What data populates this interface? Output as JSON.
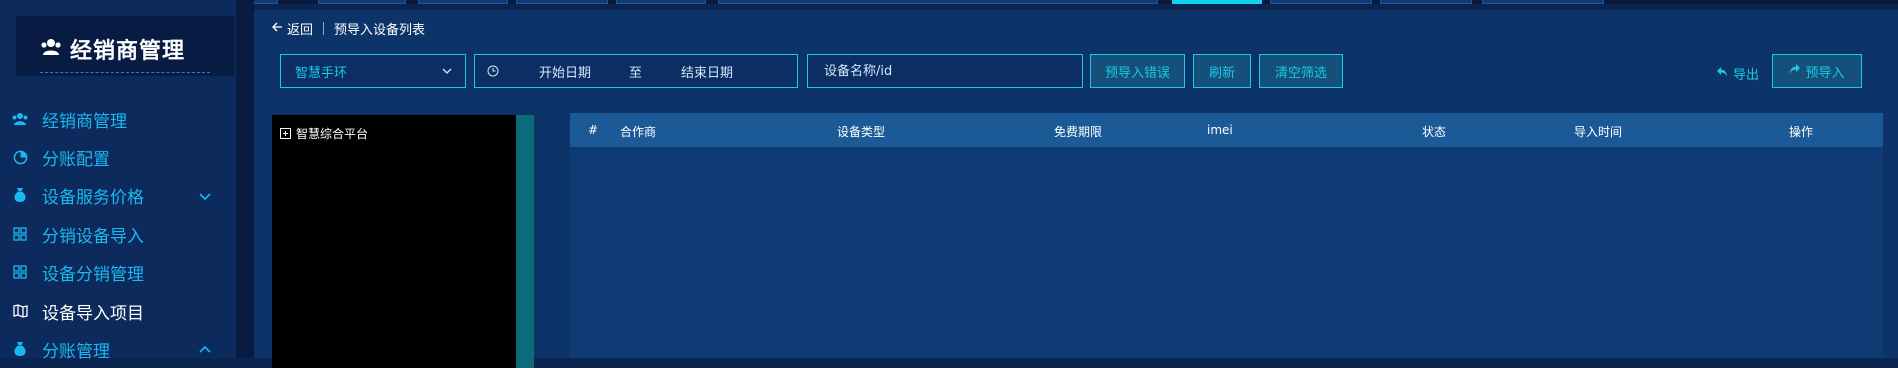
{
  "colors": {
    "accent": "#19c9e6",
    "menu_text": "#1ab8f0",
    "sidebar_bg": "#0c2b5c",
    "main_bg": "#0d3469",
    "table_header_bg": "#1b5a97"
  },
  "sidebar": {
    "title": "经销商管理",
    "title_icon": "users-icon",
    "items": [
      {
        "label": "经销商管理",
        "icon": "users-icon"
      },
      {
        "label": "分账配置",
        "icon": "pie-chart-icon"
      },
      {
        "label": "设备服务价格",
        "icon": "money-bag-icon",
        "arrow": "chevron-down-icon"
      },
      {
        "label": "分销设备导入",
        "icon": "grid-icon"
      },
      {
        "label": "设备分销管理",
        "icon": "grid-icon"
      },
      {
        "label": "设备导入项目",
        "icon": "map-icon",
        "current": true
      },
      {
        "label": "分账管理",
        "icon": "money-bag-icon",
        "arrow": "chevron-up-icon"
      }
    ]
  },
  "breadcrumb": {
    "back_label": "返回",
    "page_title": "预导入设备列表"
  },
  "filters": {
    "device_select": "智慧手环",
    "start_date": "开始日期",
    "range_sep": "至",
    "end_date": "结束日期",
    "search_placeholder": "设备名称/id",
    "btn_pre_import_errors": "预导入错误",
    "btn_refresh": "刷新",
    "btn_clear_filters": "清空筛选",
    "export_label": "导出",
    "pre_import_label": "预导入"
  },
  "tree": {
    "root_label": "智慧综合平台"
  },
  "table": {
    "columns": [
      "#",
      "合作商",
      "设备类型",
      "免费期限",
      "imei",
      "状态",
      "导入时间",
      "操作"
    ],
    "rows": []
  }
}
